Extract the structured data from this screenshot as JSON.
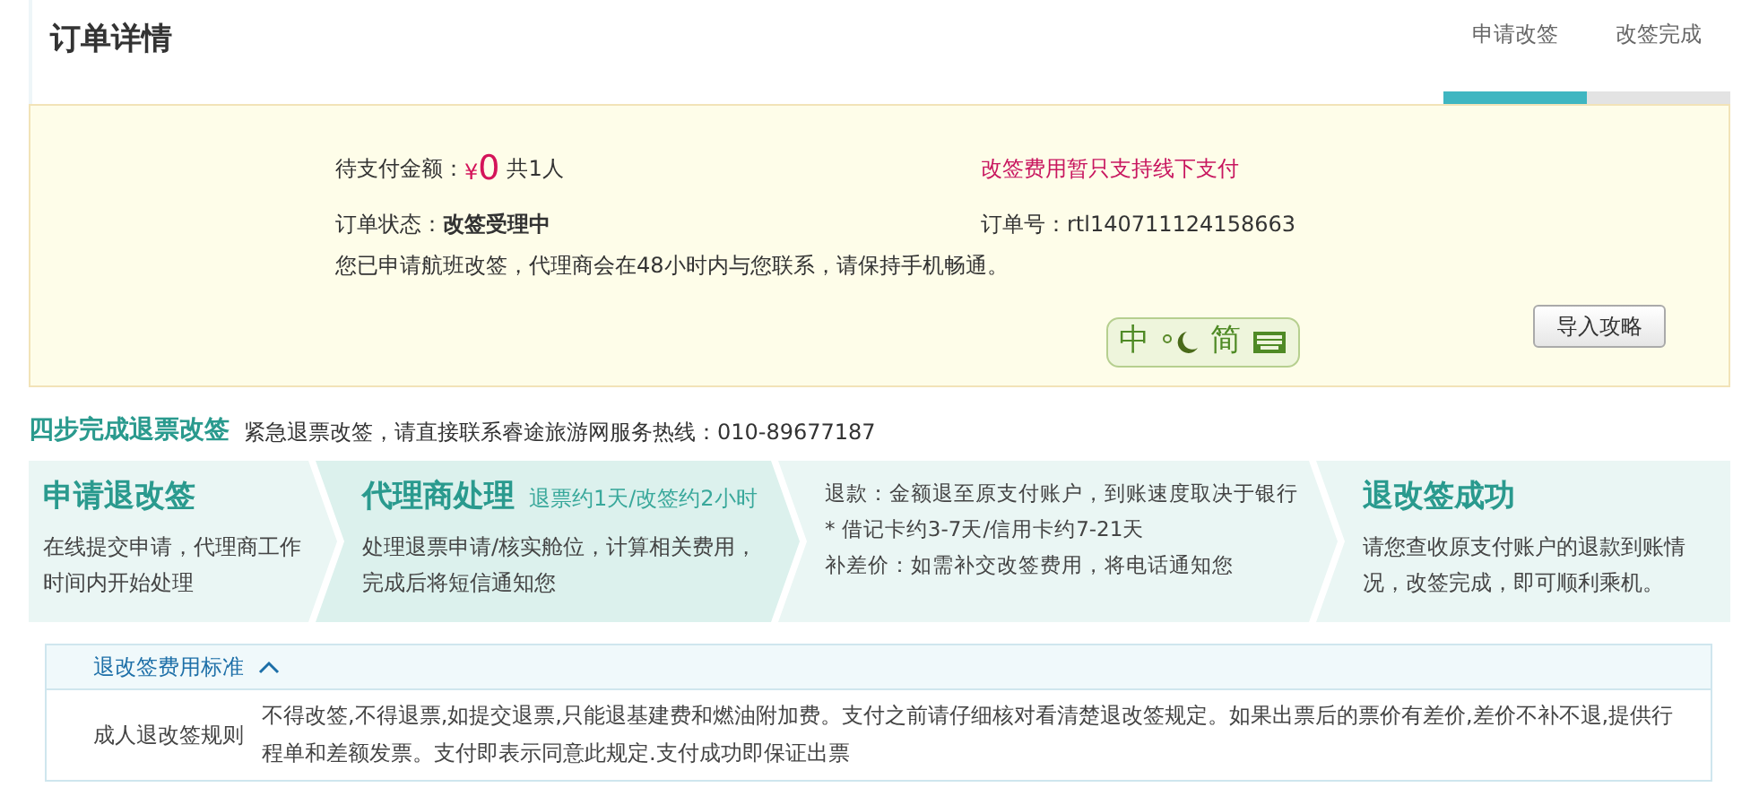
{
  "header": {
    "title": "订单详情",
    "progress": [
      {
        "label": "申请改签",
        "selected": true
      },
      {
        "label": "改签完成",
        "selected": false
      }
    ]
  },
  "order": {
    "amount_label": "待支付金额：",
    "currency": "¥",
    "amount": "0",
    "people": "共1人",
    "notice": "改签费用暂只支持线下支付",
    "status_label": "订单状态：",
    "status": "改签受理中",
    "order_no_label": "订单号：",
    "order_no": "rtl140711124158663",
    "message": "您已申请航班改签，代理商会在48小时内与您联系，请保持手机畅通。",
    "ime": {
      "mode": "中",
      "script": "简"
    },
    "guide_button": "导入攻略"
  },
  "steps_heading": {
    "title": "四步完成退票改签",
    "hotline": "紧急退票改签，请直接联系睿途旅游网服务热线：010-89677187"
  },
  "steps": [
    {
      "title": "申请退改签",
      "selected": false,
      "lines": [
        "在线提交申请，代理商工作时间内开始处理"
      ]
    },
    {
      "title": "代理商处理",
      "subtitle": "退票约1天/改签约2小时",
      "selected": true,
      "lines": [
        "处理退票申请/核实舱位，计算相关费用，完成后将短信通知您"
      ]
    },
    {
      "selected": false,
      "lines": [
        "退款：金额退至原支付账户，到账速度取决于银行",
        "* 借记卡约3-7天/信用卡约7-21天",
        "补差价：如需补交改签费用，将电话通知您"
      ]
    },
    {
      "title": "退改签成功",
      "selected": false,
      "lines": [
        "请您查收原支付账户的退款到账情况，改签完成，即可顺利乘机。"
      ]
    }
  ],
  "rules": {
    "title": "退改签费用标准",
    "expanded": true,
    "rows": [
      {
        "label": "成人退改签规则",
        "text": "不得改签,不得退票,如提交退票,只能退基建费和燃油附加费。支付之前请仔细核对看清楚退改签规定。如果出票后的票价有差价,差价不补不退,提供行程单和差额发票。支付即表示同意此规定.支付成功即保证出票"
      }
    ]
  }
}
